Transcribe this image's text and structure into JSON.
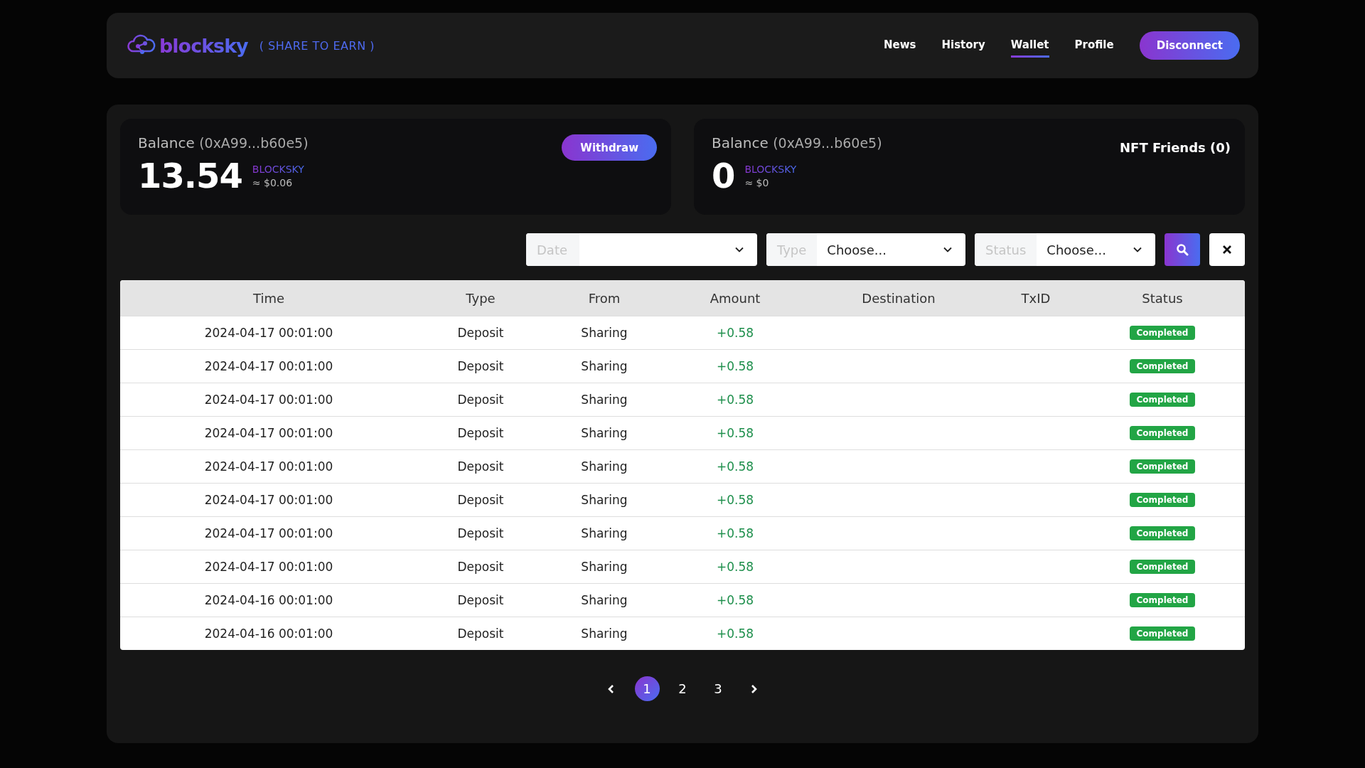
{
  "header": {
    "logo": "blocksky",
    "tagline": "( SHARE TO EARN )",
    "nav": [
      {
        "label": "News",
        "selected": false
      },
      {
        "label": "History",
        "selected": false
      },
      {
        "label": "Wallet",
        "selected": true
      },
      {
        "label": "Profile",
        "selected": false
      }
    ],
    "action": "Disconnect"
  },
  "balances": [
    {
      "label": "Balance",
      "address": "(0xA99...b60e5)",
      "amount": "13.54",
      "token": "BLOCKSKY",
      "fiat": "≈ $0.06",
      "extra": {
        "kind": "button",
        "text": "Withdraw"
      }
    },
    {
      "label": "Balance",
      "address": "(0xA99...b60e5)",
      "amount": "0",
      "token": "BLOCKSKY",
      "fiat": "≈ $0",
      "extra": {
        "kind": "text",
        "text": "NFT Friends (0)"
      }
    }
  ],
  "filters": [
    {
      "label": "Date"
    },
    {
      "label": "Type",
      "value": "Choose..."
    },
    {
      "label": "Status",
      "value": "Choose..."
    }
  ],
  "table": {
    "columns": [
      "Time",
      "Type",
      "From",
      "Amount",
      "Destination",
      "TxID",
      "Status"
    ],
    "rows": [
      {
        "time": "2024-04-17 00:01:00",
        "type": "Deposit",
        "from": "Sharing",
        "amount": "+0.58",
        "status": "Completed"
      },
      {
        "time": "2024-04-17 00:01:00",
        "type": "Deposit",
        "from": "Sharing",
        "amount": "+0.58",
        "status": "Completed"
      },
      {
        "time": "2024-04-17 00:01:00",
        "type": "Deposit",
        "from": "Sharing",
        "amount": "+0.58",
        "status": "Completed"
      },
      {
        "time": "2024-04-17 00:01:00",
        "type": "Deposit",
        "from": "Sharing",
        "amount": "+0.58",
        "status": "Completed"
      },
      {
        "time": "2024-04-17 00:01:00",
        "type": "Deposit",
        "from": "Sharing",
        "amount": "+0.58",
        "status": "Completed"
      },
      {
        "time": "2024-04-17 00:01:00",
        "type": "Deposit",
        "from": "Sharing",
        "amount": "+0.58",
        "status": "Completed"
      },
      {
        "time": "2024-04-17 00:01:00",
        "type": "Deposit",
        "from": "Sharing",
        "amount": "+0.58",
        "status": "Completed"
      },
      {
        "time": "2024-04-17 00:01:00",
        "type": "Deposit",
        "from": "Sharing",
        "amount": "+0.58",
        "status": "Completed"
      },
      {
        "time": "2024-04-16 00:01:00",
        "type": "Deposit",
        "from": "Sharing",
        "amount": "+0.58",
        "status": "Completed"
      },
      {
        "time": "2024-04-16 00:01:00",
        "type": "Deposit",
        "from": "Sharing",
        "amount": "+0.58",
        "status": "Completed"
      }
    ]
  },
  "pagination": [
    {
      "label": "1",
      "selected": true
    },
    {
      "label": "2",
      "selected": false
    },
    {
      "label": "3",
      "selected": false
    }
  ]
}
